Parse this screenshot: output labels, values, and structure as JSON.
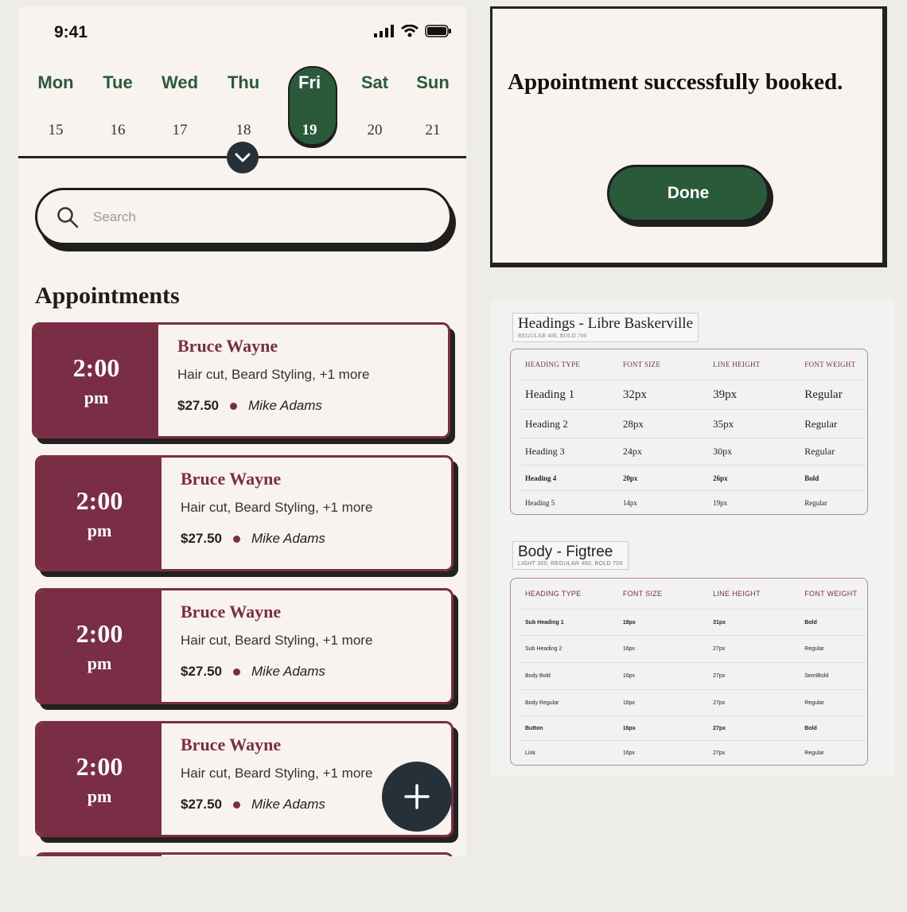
{
  "status_bar": {
    "time": "9:41"
  },
  "calendar": {
    "days": [
      {
        "name": "Mon",
        "num": "15"
      },
      {
        "name": "Tue",
        "num": "16"
      },
      {
        "name": "Wed",
        "num": "17"
      },
      {
        "name": "Thu",
        "num": "18"
      },
      {
        "name": "Fri",
        "num": "19",
        "active": true
      },
      {
        "name": "Sat",
        "num": "20"
      },
      {
        "name": "Sun",
        "num": "21"
      }
    ],
    "expand_icon": "chevron-down-icon"
  },
  "search": {
    "placeholder": "Search",
    "value": "",
    "icon": "search-icon"
  },
  "appointments": {
    "title": "Appointments",
    "items": [
      {
        "time": "2:00",
        "ampm": "pm",
        "name": "Bruce Wayne",
        "services": "Hair cut, Beard Styling, +1 more",
        "price": "$27.50",
        "barber": "Mike Adams"
      },
      {
        "time": "2:00",
        "ampm": "pm",
        "name": "Bruce Wayne",
        "services": "Hair cut, Beard Styling, +1 more",
        "price": "$27.50",
        "barber": "Mike Adams"
      },
      {
        "time": "2:00",
        "ampm": "pm",
        "name": "Bruce Wayne",
        "services": "Hair cut, Beard Styling, +1 more",
        "price": "$27.50",
        "barber": "Mike Adams"
      },
      {
        "time": "2:00",
        "ampm": "pm",
        "name": "Bruce Wayne",
        "services": "Hair cut, Beard Styling, +1 more",
        "price": "$27.50",
        "barber": "Mike Adams"
      }
    ]
  },
  "fab": {
    "icon": "plus-icon"
  },
  "dialog": {
    "message": "Appointment successfully booked.",
    "done_label": "Done"
  },
  "typography": {
    "headings": {
      "title": "Headings - Libre Baskerville",
      "subtitle": "REGULAR 400, BOLD 700",
      "columns": [
        "HEADING TYPE",
        "FONT SIZE",
        "LINE HEIGHT",
        "FONT WEIGHT"
      ],
      "rows": [
        [
          "Heading 1",
          "32px",
          "39px",
          "Regular"
        ],
        [
          "Heading 2",
          "28px",
          "35px",
          "Regular"
        ],
        [
          "Heading 3",
          "24px",
          "30px",
          "Regular"
        ],
        [
          "Heading 4",
          "20px",
          "26px",
          "Bold"
        ],
        [
          "Heading 5",
          "14px",
          "19px",
          "Regular"
        ]
      ]
    },
    "body": {
      "title": "Body - Figtree",
      "subtitle": "LIGHT 300, REGULAR 400, BOLD 700",
      "columns": [
        "HEADING TYPE",
        "FONT SIZE",
        "LINE HEIGHT",
        "FONT WEIGHT"
      ],
      "rows": [
        [
          "Sub Heading 1",
          "18px",
          "31px",
          "Bold"
        ],
        [
          "Sub Heading 2",
          "16px",
          "27px",
          "Regular"
        ],
        [
          "Body Bold",
          "16px",
          "27px",
          "SemiBold"
        ],
        [
          "Body Regular",
          "16px",
          "27px",
          "Regular"
        ],
        [
          "Button",
          "16px",
          "27px",
          "Bold"
        ],
        [
          "Link",
          "16px",
          "27px",
          "Regular"
        ]
      ]
    }
  },
  "colors": {
    "primary_green": "#2b5a3b",
    "maroon": "#7a2e45",
    "dark": "#263038",
    "cream": "#f8f3ef"
  }
}
